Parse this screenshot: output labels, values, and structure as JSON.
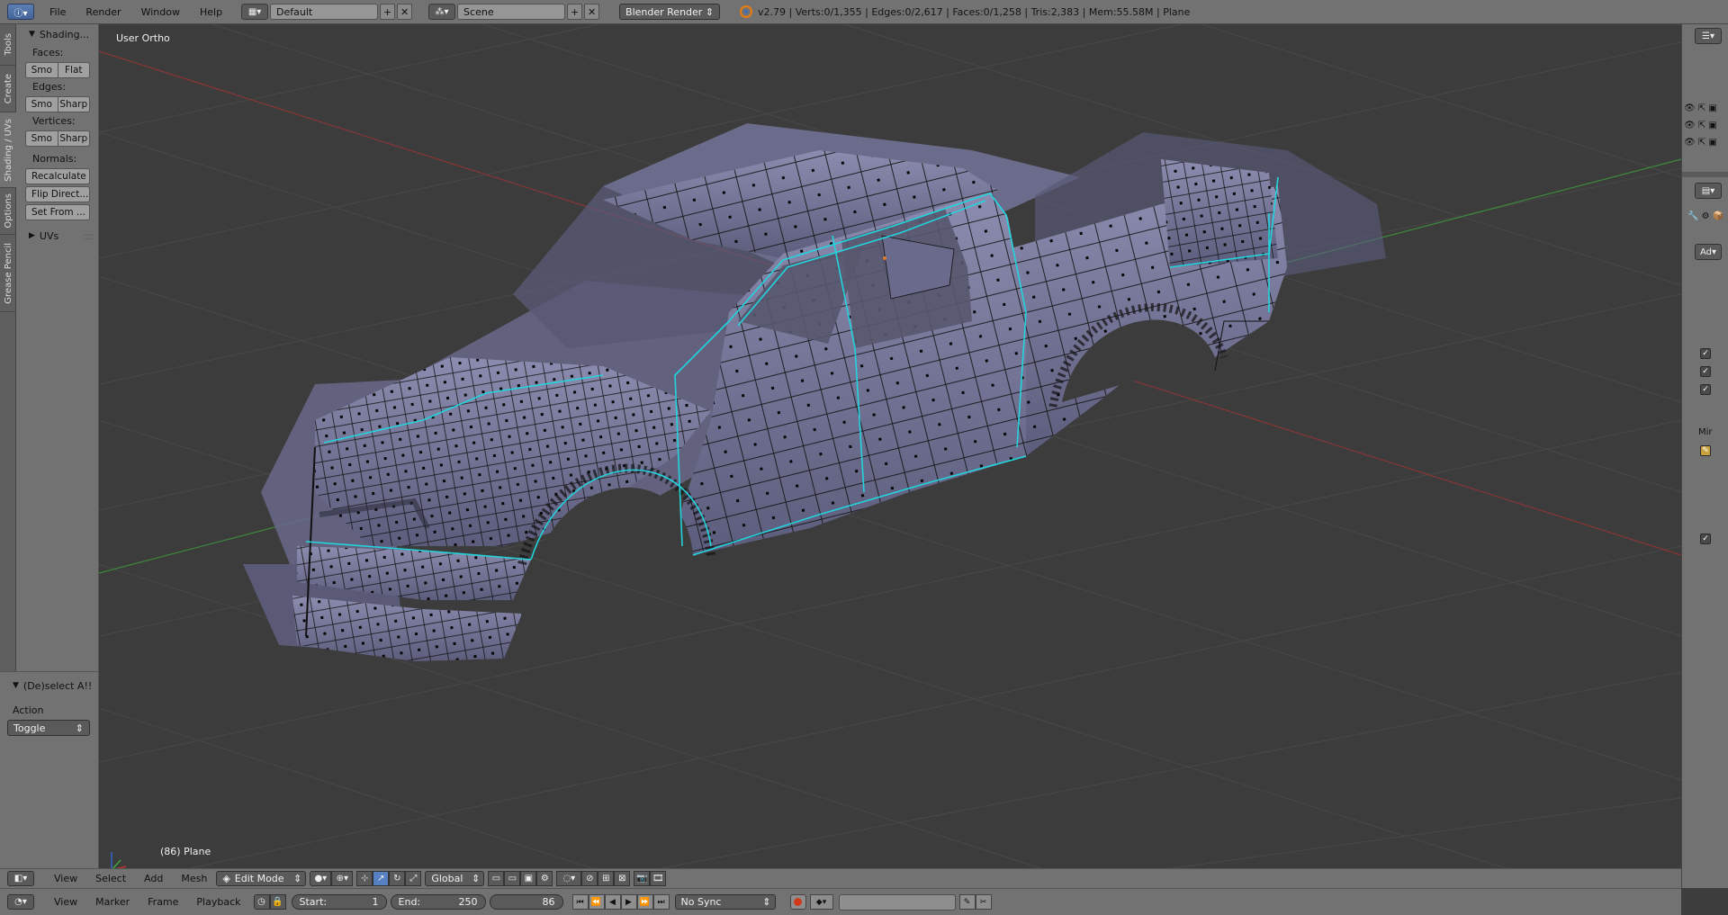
{
  "topbar": {
    "editor_icon": "info-icon",
    "menus": [
      "File",
      "Render",
      "Window",
      "Help"
    ],
    "layout": "Default",
    "scene": "Scene",
    "render_engine": "Blender Render",
    "stats": "v2.79 | Verts:0/1,355 | Edges:0/2,617 | Faces:0/1,258 | Tris:2,383 | Mem:55.58M | Plane"
  },
  "tabs": [
    "Tools",
    "Create",
    "Shading / UVs",
    "Options",
    "Grease Pencil"
  ],
  "toolshelf": {
    "panel_title": "Shading...",
    "faces_label": "Faces:",
    "faces_buttons": [
      "Smo",
      "Flat"
    ],
    "edges_label": "Edges:",
    "edges_buttons": [
      "Smo",
      "Sharp"
    ],
    "vertices_label": "Vertices:",
    "vertices_buttons": [
      "Smo",
      "Sharp"
    ],
    "normals_label": "Normals:",
    "recalculate": "Recalculate",
    "flip_direction": "Flip Direct...",
    "set_from": "Set From ...",
    "uvs_panel": "UVs"
  },
  "operator": {
    "title": "(De)select A!!",
    "action_label": "Action",
    "action_value": "Toggle"
  },
  "viewport": {
    "view_label": "User Ortho",
    "object_label": "(86) Plane",
    "colors": {
      "background": "#3c3c3c",
      "grid": "#4a4a4a",
      "x_axis": "#8a3535",
      "y_axis": "#3c8a3c",
      "mesh": "#6a6a8c",
      "mesh_light": "#8585a8",
      "wire": "#111111",
      "seam": "#22d4dc"
    }
  },
  "view3d_header": {
    "menus": [
      "View",
      "Select",
      "Add",
      "Mesh"
    ],
    "mode": "Edit Mode",
    "orientation": "Global"
  },
  "timeline_header": {
    "menus": [
      "View",
      "Marker",
      "Frame",
      "Playback"
    ],
    "start_label": "Start:",
    "start_value": "1",
    "end_label": "End:",
    "end_value": "250",
    "current_frame": "86",
    "sync": "No Sync"
  },
  "right_strip": {
    "add_label": "Ad",
    "mirror_label": "Mir"
  }
}
